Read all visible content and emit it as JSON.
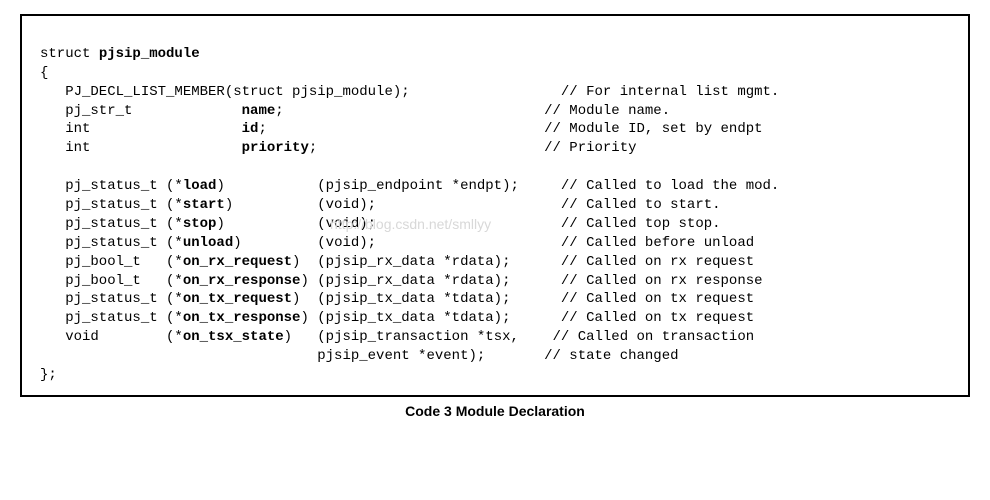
{
  "caption": "Code 3 Module Declaration",
  "watermark": "http://blog.csdn.net/smllyy",
  "code": {
    "l1": "struct ",
    "l1b": "pjsip_module",
    "l2": "{",
    "l3": "   PJ_DECL_LIST_MEMBER(struct pjsip_module);                  // For internal list mgmt.",
    "l4a": "   pj_str_t             ",
    "l4b": "name",
    "l4c": ";                               // Module name.",
    "l5a": "   int                  ",
    "l5b": "id",
    "l5c": ";                                 // Module ID, set by endpt",
    "l6a": "   int                  ",
    "l6b": "priority",
    "l6c": ";                           // Priority",
    "l7": "",
    "l8a": "   pj_status_t (*",
    "l8b": "load",
    "l8c": ")           (pjsip_endpoint *endpt);     // Called to load the mod.",
    "l9a": "   pj_status_t (*",
    "l9b": "start",
    "l9c": ")          (void);                      // Called to start.",
    "l10a": "   pj_status_t (*",
    "l10b": "stop",
    "l10c": ")           (void);                      // Called top stop.",
    "l11a": "   pj_status_t (*",
    "l11b": "unload",
    "l11c": ")         (void);                      // Called before unload",
    "l12a": "   pj_bool_t   (*",
    "l12b": "on_rx_request",
    "l12c": ")  (pjsip_rx_data *rdata);      // Called on rx request",
    "l13a": "   pj_bool_t   (*",
    "l13b": "on_rx_response",
    "l13c": ") (pjsip_rx_data *rdata);      // Called on rx response",
    "l14a": "   pj_status_t (*",
    "l14b": "on_tx_request",
    "l14c": ")  (pjsip_tx_data *tdata);      // Called on tx request",
    "l15a": "   pj_status_t (*",
    "l15b": "on_tx_response",
    "l15c": ") (pjsip_tx_data *tdata);      // Called on tx request",
    "l16a": "   void        (*",
    "l16b": "on_tsx_state",
    "l16c": ")   (pjsip_transaction *tsx,    // Called on transaction",
    "l17": "                                 pjsip_event *event);       // state changed",
    "l18": "};"
  }
}
